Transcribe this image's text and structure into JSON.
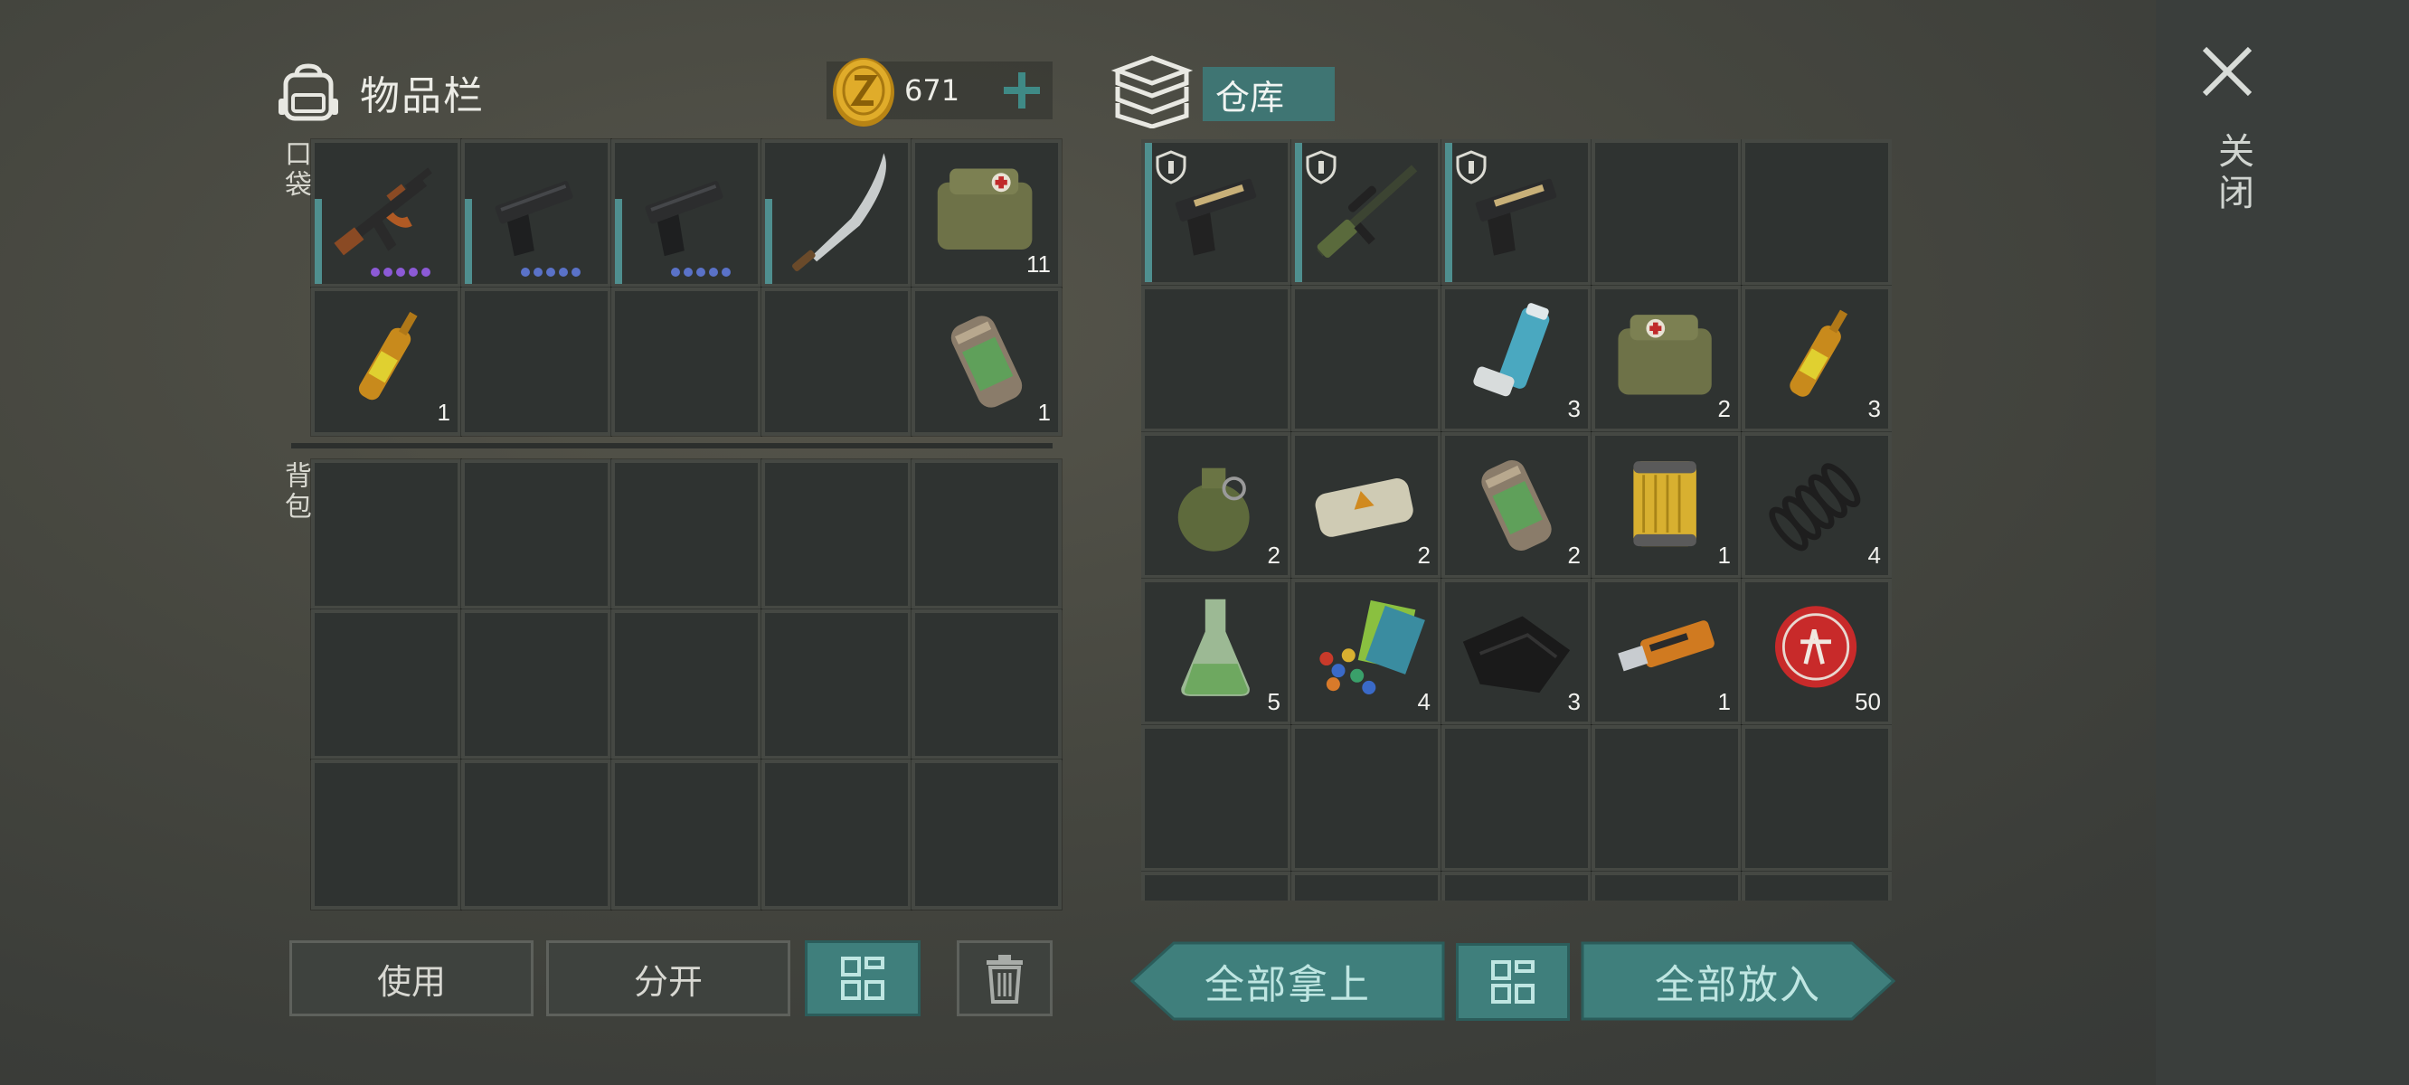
{
  "inventory": {
    "title": "物品栏",
    "coins": "671",
    "pocket_label": "口袋",
    "backpack_label": "背包",
    "pocket_slots": [
      {
        "item": "assault-rifle",
        "dots": "purple"
      },
      {
        "item": "pistol",
        "dots": "blue"
      },
      {
        "item": "pistol",
        "dots": "blue"
      },
      {
        "item": "machete",
        "dots": ""
      },
      {
        "item": "medkit-bag",
        "qty": "11"
      },
      {
        "item": "adrenaline-vial",
        "qty": "1"
      },
      {
        "item": "",
        "qty": ""
      },
      {
        "item": "",
        "qty": ""
      },
      {
        "item": "",
        "qty": ""
      },
      {
        "item": "cryo-canister",
        "qty": "1"
      }
    ]
  },
  "storage": {
    "title": "仓库",
    "slots": [
      {
        "item": "gold-pistol",
        "qty": ""
      },
      {
        "item": "sniper-rifle",
        "qty": ""
      },
      {
        "item": "gold-pistol",
        "qty": ""
      },
      {
        "item": "",
        "qty": ""
      },
      {
        "item": "",
        "qty": ""
      },
      {
        "item": "",
        "qty": ""
      },
      {
        "item": "",
        "qty": ""
      },
      {
        "item": "inhaler",
        "qty": "3"
      },
      {
        "item": "medkit-bag",
        "qty": "2"
      },
      {
        "item": "adrenaline-vial",
        "qty": "3"
      },
      {
        "item": "frag-grenade",
        "qty": "2"
      },
      {
        "item": "explosive-brick",
        "qty": "2"
      },
      {
        "item": "cryo-canister",
        "qty": "2"
      },
      {
        "item": "oil-filter",
        "qty": "1"
      },
      {
        "item": "spring",
        "qty": "4"
      },
      {
        "item": "flask",
        "qty": "5"
      },
      {
        "item": "pills-and-cards",
        "qty": "4"
      },
      {
        "item": "black-cloth",
        "qty": "3"
      },
      {
        "item": "usb-drive",
        "qty": "1"
      },
      {
        "item": "bottle-cap",
        "qty": "50"
      }
    ]
  },
  "close_label": "关闭",
  "buttons": {
    "use": "使用",
    "split": "分开",
    "take_all": "全部拿上",
    "put_all": "全部放入"
  },
  "colors": {
    "teal": "#3f7f7c",
    "slot_bg": "#2f3331",
    "accent_bar": "#4f8f8f",
    "coin": "#d4a020"
  }
}
